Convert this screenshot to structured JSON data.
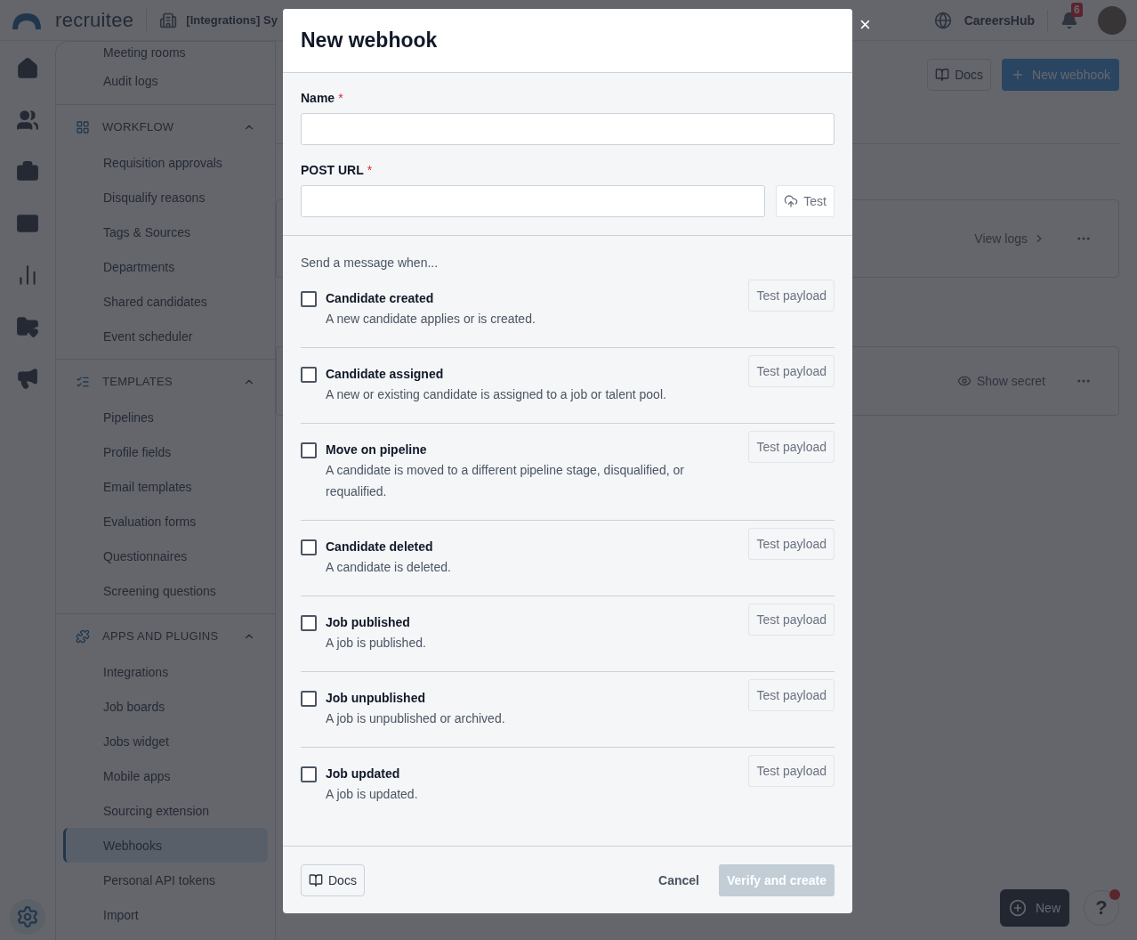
{
  "header": {
    "logo": "recruitee",
    "company": "[Integrations] Sy",
    "hub": "CareersHub",
    "notifications": "6"
  },
  "sidebar": {
    "top_items": [
      {
        "label": "Meeting rooms",
        "selected": false
      },
      {
        "label": "Audit logs",
        "selected": false
      }
    ],
    "sections": [
      {
        "title": "WORKFLOW",
        "expanded": true,
        "items": [
          {
            "label": "Requisition approvals",
            "selected": false
          },
          {
            "label": "Disqualify reasons",
            "selected": false
          },
          {
            "label": "Tags & Sources",
            "selected": false
          },
          {
            "label": "Departments",
            "selected": false
          },
          {
            "label": "Shared candidates",
            "selected": false
          },
          {
            "label": "Event scheduler",
            "selected": false
          }
        ]
      },
      {
        "title": "TEMPLATES",
        "expanded": true,
        "items": [
          {
            "label": "Pipelines",
            "selected": false
          },
          {
            "label": "Profile fields",
            "selected": false
          },
          {
            "label": "Email templates",
            "selected": false
          },
          {
            "label": "Evaluation forms",
            "selected": false
          },
          {
            "label": "Questionnaires",
            "selected": false
          },
          {
            "label": "Screening questions",
            "selected": false
          }
        ]
      },
      {
        "title": "APPS AND PLUGINS",
        "expanded": true,
        "items": [
          {
            "label": "Integrations",
            "selected": false
          },
          {
            "label": "Job boards",
            "selected": false
          },
          {
            "label": "Jobs widget",
            "selected": false
          },
          {
            "label": "Mobile apps",
            "selected": false
          },
          {
            "label": "Sourcing extension",
            "selected": false
          },
          {
            "label": "Webhooks",
            "selected": true
          },
          {
            "label": "Personal API tokens",
            "selected": false
          },
          {
            "label": "Import",
            "selected": false
          }
        ]
      }
    ]
  },
  "page": {
    "docs": "Docs",
    "new_webhook": "New webhook",
    "view_logs": "View logs",
    "show_secret": "Show secret",
    "new": "New",
    "help": "?"
  },
  "modal": {
    "title": "New webhook",
    "close": "×",
    "fields": [
      {
        "label": "Name",
        "required": true,
        "required_mark": "*"
      },
      {
        "label": "POST URL",
        "required": true,
        "required_mark": "*",
        "test": "Test"
      }
    ],
    "events_heading": "Send a message when...",
    "events": [
      {
        "title": "Candidate created",
        "description": "A new candidate applies or is created.",
        "checked": false,
        "test_payload": "Test payload"
      },
      {
        "title": "Candidate assigned",
        "description": "A new or existing candidate is assigned to a job or talent pool.",
        "checked": false,
        "test_payload": "Test payload"
      },
      {
        "title": "Move on pipeline",
        "description": "A candidate is moved to a different pipeline stage, disqualified, or requalified.",
        "checked": false,
        "test_payload": "Test payload"
      },
      {
        "title": "Candidate deleted",
        "description": "A candidate is deleted.",
        "checked": false,
        "test_payload": "Test payload"
      },
      {
        "title": "Job published",
        "description": "A job is published.",
        "checked": false,
        "test_payload": "Test payload"
      },
      {
        "title": "Job unpublished",
        "description": "A job is unpublished or archived.",
        "checked": false,
        "test_payload": "Test payload"
      },
      {
        "title": "Job updated",
        "description": "A job is updated.",
        "checked": false,
        "test_payload": "Test payload"
      }
    ],
    "footer": {
      "docs": "Docs",
      "cancel": "Cancel",
      "submit": "Verify and create",
      "submit_disabled": true
    }
  }
}
